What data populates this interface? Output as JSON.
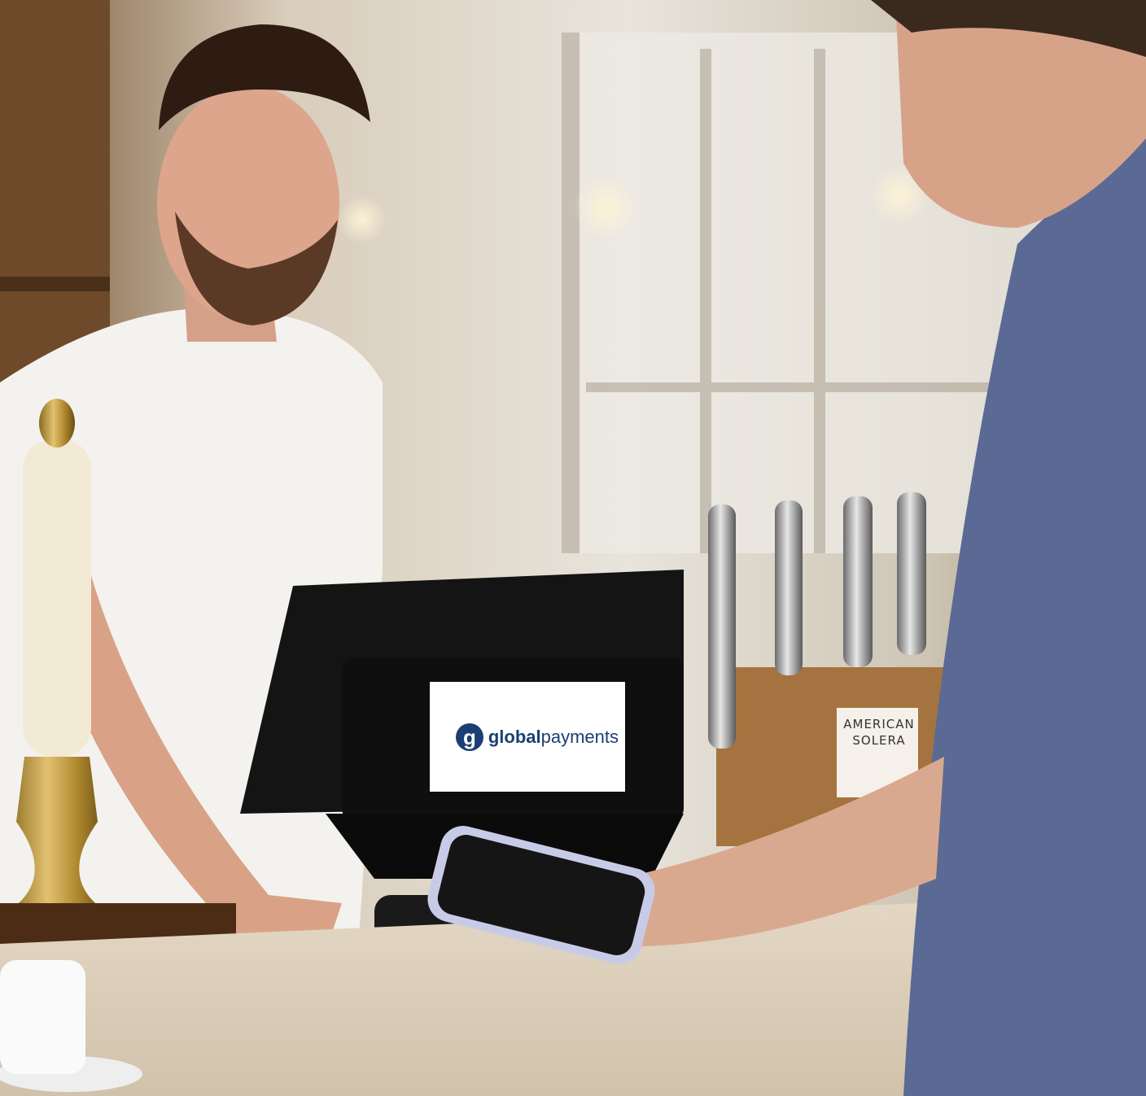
{
  "photo": {
    "screen_logo": {
      "brand_bold": "global",
      "brand_light": "payments",
      "logo_letter": "g"
    },
    "sign": {
      "line1": "AMERICAN",
      "line2": "SOLERA"
    }
  },
  "colors": {
    "brand_blue": "#1b3f73",
    "bg_warm": "#cdb89a",
    "shirt_blue": "#5a6a94",
    "wood": "#8a5a2e"
  }
}
